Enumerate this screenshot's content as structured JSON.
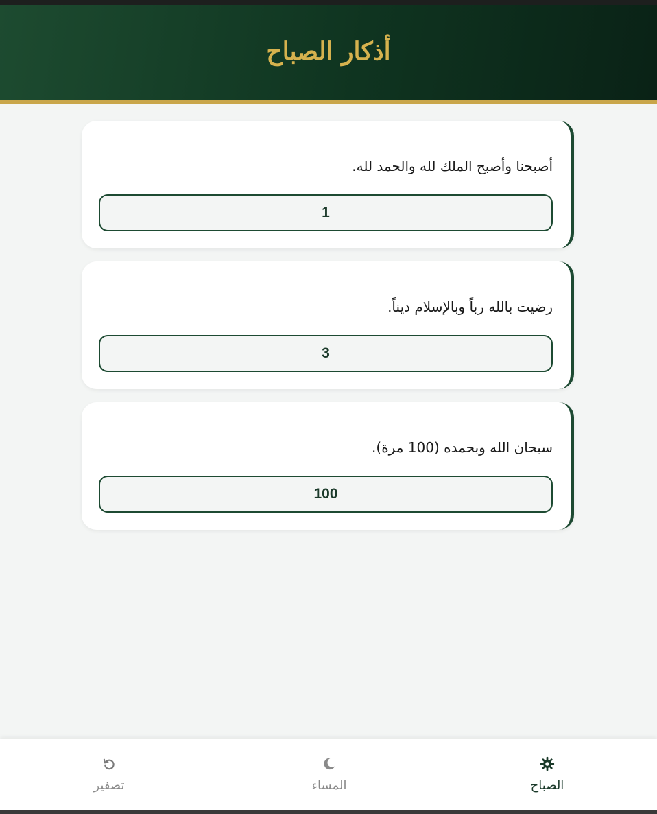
{
  "header": {
    "title": "أذكار الصباح"
  },
  "cards": [
    {
      "text": "أصبحنا وأصبح الملك لله والحمد لله.",
      "count": "1"
    },
    {
      "text": "رضيت بالله رباً وبالإسلام ديناً.",
      "count": "3"
    },
    {
      "text": "سبحان الله وبحمده (100 مرة).",
      "count": "100"
    }
  ],
  "nav": {
    "morning": {
      "label": "الصباح",
      "icon": "sun-gear-icon"
    },
    "evening": {
      "label": "المساء",
      "icon": "moon-icon"
    },
    "reset": {
      "label": "تصفير",
      "icon": "refresh-icon"
    }
  },
  "colors": {
    "primary_green": "#1d4a32",
    "gold": "#c9a64a",
    "background": "#f3f5f4"
  }
}
